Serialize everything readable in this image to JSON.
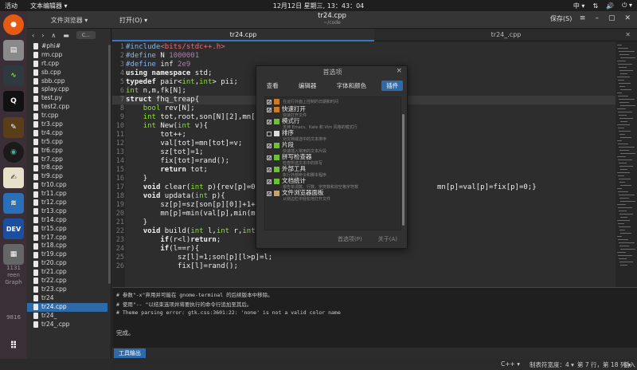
{
  "topbar": {
    "activities": "活动",
    "app_menu": "文本编辑器 ▾",
    "clock": "12月12日 星期三, 13：43：04",
    "input_method": "中 ▾",
    "power": "⏻ ▾"
  },
  "dock": {
    "ghost_labels": [
      "1131",
      "reen",
      "Graph",
      "9816"
    ]
  },
  "window": {
    "sidebar_title": "文件浏览器 ▾",
    "open_label": "打开(O) ▾",
    "file_title": "tr24.cpp",
    "file_path": "~/code",
    "save_label": "保存(S)",
    "location_label": "C..."
  },
  "tabs": [
    {
      "label": "tr24.cpp"
    },
    {
      "label": "tr24_.cpp"
    }
  ],
  "files": [
    "#phi#",
    "rm.cpp",
    "rt.cpp",
    "sb.cpp",
    "sbb.cpp",
    "splay.cpp",
    "test.py",
    "test2.cpp",
    "tr.cpp",
    "tr3.cpp",
    "tr4.cpp",
    "tr5.cpp",
    "tr6.cpp",
    "tr7.cpp",
    "tr8.cpp",
    "tr9.cpp",
    "tr10.cpp",
    "tr11.cpp",
    "tr12.cpp",
    "tr13.cpp",
    "tr14.cpp",
    "tr15.cpp",
    "tr17.cpp",
    "tr18.cpp",
    "tr19.cpp",
    "tr20.cpp",
    "tr21.cpp",
    "tr22.cpp",
    "tr23.cpp",
    "tr24",
    "tr24.cpp",
    "tr24_",
    "tr24_.cpp"
  ],
  "selected_file": "tr24.cpp",
  "code": [
    {
      "n": "1",
      "t": "#include<bits/stdc++.h>"
    },
    {
      "n": "2",
      "t": "#define N 1000001"
    },
    {
      "n": "3",
      "t": "#define inf 2e9"
    },
    {
      "n": "4",
      "t": "using namespace std;"
    },
    {
      "n": "5",
      "t": "typedef pair<int,int> pii;"
    },
    {
      "n": "6",
      "t": "int n,m,fk[N];"
    },
    {
      "n": "7",
      "t": "struct fhq_treap{"
    },
    {
      "n": "8",
      "t": "    bool rev[N];"
    },
    {
      "n": "9",
      "t": "    int tot,root,son[N][2],mn["
    },
    {
      "n": "10",
      "t": "    int New(int v){"
    },
    {
      "n": "11",
      "t": "        tot++;"
    },
    {
      "n": "12",
      "t": "        val[tot]=mn[tot]=v;"
    },
    {
      "n": "13",
      "t": "        sz[tot]=1;"
    },
    {
      "n": "14",
      "t": "        fix[tot]=rand();"
    },
    {
      "n": "15",
      "t": "        return tot;"
    },
    {
      "n": "16",
      "t": "    }"
    },
    {
      "n": "17",
      "t": "    void clear(int p){rev[p]=0"
    },
    {
      "n": "18",
      "t": "    void updata(int p){"
    },
    {
      "n": "19",
      "t": "        sz[p]=sz[son[p][0]]+1+"
    },
    {
      "n": "20",
      "t": "        mn[p]=min(val[p],min(m"
    },
    {
      "n": "21",
      "t": "    }"
    },
    {
      "n": "22",
      "t": "    void build(int l,int r,int"
    },
    {
      "n": "23",
      "t": "        if(r<l)return;"
    },
    {
      "n": "24",
      "t": "        if(l==r){"
    },
    {
      "n": "25",
      "t": "            sz[l]=1;son[p][l>p]=l;"
    },
    {
      "n": "26",
      "t": "            fix[l]=rand();"
    }
  ],
  "code_right_fragment": "mn[p]=val[p]=fix[p]=0;}",
  "dialog": {
    "title": "首选项",
    "close": "×",
    "tabs": [
      "查看",
      "编辑器",
      "字体和颜色",
      "插件"
    ],
    "active_tab": "插件",
    "plugins": [
      {
        "name": "",
        "desc": "在运行外面上控制的日期和时间",
        "checked": true
      },
      {
        "name": "快速打开",
        "desc": "快速打开文件",
        "checked": true
      },
      {
        "name": "模式行",
        "desc": "支持 Emacs、Kate 和 Vim 风格的模式行",
        "checked": true
      },
      {
        "name": "排序",
        "desc": "对文档或选中的文本排序",
        "checked": false
      },
      {
        "name": "片段",
        "desc": "快速插入常用的文本片段",
        "checked": true
      },
      {
        "name": "拼写检查器",
        "desc": "检查所选文本中的拼写",
        "checked": true
      },
      {
        "name": "外部工具",
        "desc": "执行外部命令和脚本程序",
        "checked": true
      },
      {
        "name": "文档统计",
        "desc": "报告单词数、行数、字符数和非空格字符数",
        "checked": true
      },
      {
        "name": "文件浏览器面板",
        "desc": "从侧边栏中轻松地打开文件",
        "checked": true
      }
    ],
    "btn_prefs": "首选项(P)",
    "btn_about": "关于(A)"
  },
  "panel": {
    "lines": [
      "# 参数\"-x\"弃用并可能在 gnome-terminal 的后续版本中移除。",
      "# 使用\"-- \"以结束选项并将要执行的命令行追加至其后。",
      "# Theme parsing error: gtk.css:3601:22: 'none' is not a valid color name",
      "",
      "完成。"
    ],
    "tab_label": "工具输出"
  },
  "status": {
    "lang": "C++ ▾",
    "tab_width": "制表符宽度：4 ▾",
    "position": "第 7 行，第 18 列 ▾",
    "ins": "插入"
  }
}
